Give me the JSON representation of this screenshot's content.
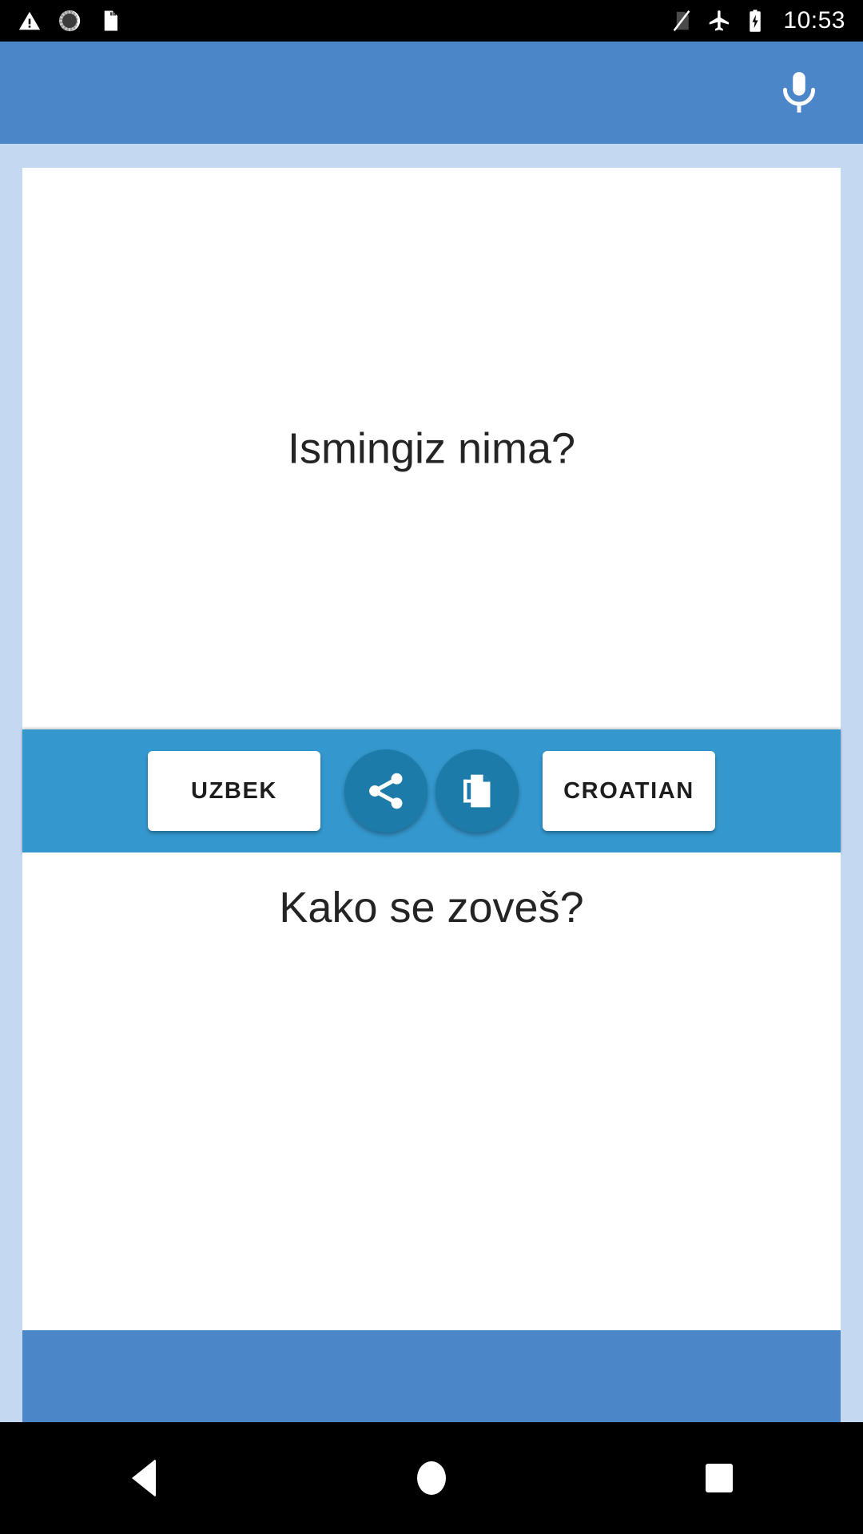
{
  "status_bar": {
    "icons_left": [
      "warning-triangle-icon",
      "sync-spinner-icon",
      "sd-card-icon"
    ],
    "icons_right": [
      "no-sim-icon",
      "airplane-mode-icon",
      "battery-charging-icon"
    ],
    "time": "10:53"
  },
  "app_bar": {
    "mic_icon": "microphone-icon",
    "background_color": "#4a86c8"
  },
  "translator": {
    "source": {
      "text": "Ismingiz nima?",
      "language_label": "UZBEK"
    },
    "target": {
      "text": "Kako se zoveš?",
      "language_label": "CROATIAN"
    },
    "actions": [
      {
        "name": "share",
        "icon": "share-icon"
      },
      {
        "name": "copy",
        "icon": "copy-icon"
      }
    ],
    "toolbar_color": "#3498ce",
    "fab_color": "#1c7ba8"
  },
  "banner": {
    "color": "#4a86c8"
  },
  "nav_bar": {
    "back_label": "Back",
    "home_label": "Home",
    "recents_label": "Recents"
  }
}
